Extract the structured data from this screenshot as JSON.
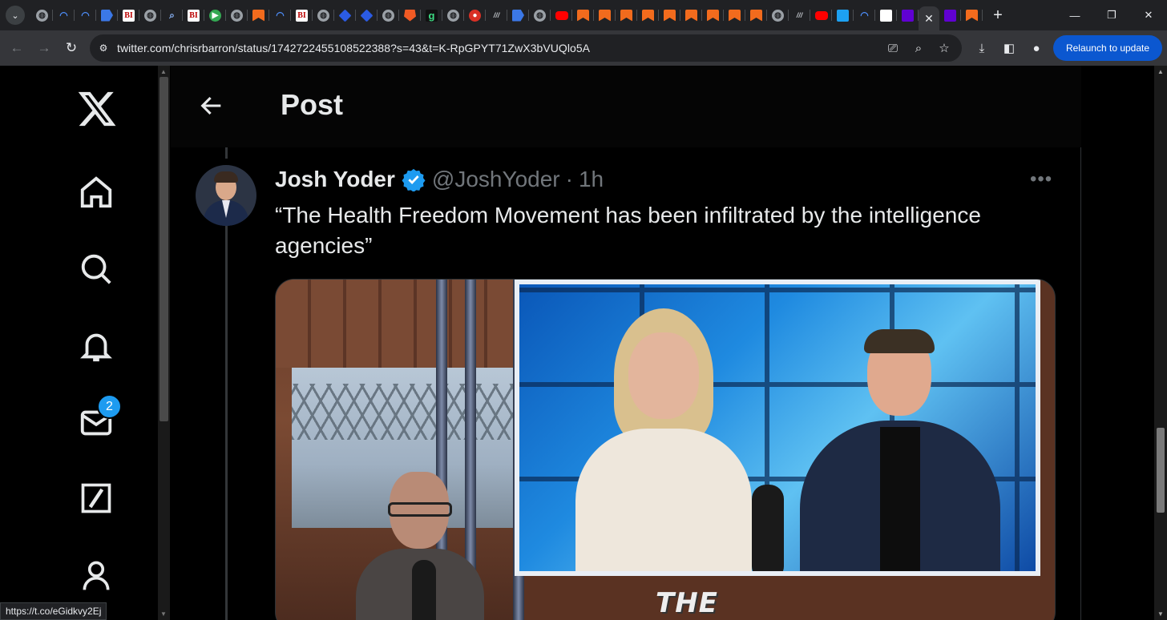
{
  "browser": {
    "url": "twitter.com/chrisrbarron/status/1742722455108522388?s=43&t=K-RpGPYT71ZwX3bVUQlo5A",
    "relaunch_label": "Relaunch to update",
    "status_url": "https://t.co/eGidkvy2Ej",
    "tab_icons": [
      "globe",
      "shield",
      "shield",
      "flag",
      "bi",
      "globe",
      "search",
      "bi",
      "play",
      "globe",
      "bookmark",
      "shield",
      "bi",
      "globe",
      "cube",
      "cube",
      "globe",
      "brave",
      "g",
      "globe",
      "mic",
      "tt",
      "flag",
      "globe",
      "yt",
      "bookmark",
      "bookmark",
      "bookmark",
      "bookmark",
      "bookmark",
      "bookmark",
      "bookmark",
      "bookmark",
      "bookmark",
      "globe",
      "tt",
      "yt",
      "blue",
      "shield",
      "wave",
      "purple"
    ],
    "active_tab_icon": "close-icon",
    "after_tabs": [
      "purple",
      "bookmark"
    ]
  },
  "page": {
    "header_title": "Post",
    "messages_badge": "2"
  },
  "post": {
    "author_name": "Josh Yoder",
    "handle": "@JoshYoder",
    "separator": "·",
    "time": "1h",
    "text": "“The Health Freedom Movement has been infiltrated by the intelligence agencies”",
    "media_overlay_text": "THE"
  },
  "colors": {
    "accent": "#1d9bf0",
    "text_primary": "#e7e9ea",
    "text_secondary": "#71767b",
    "relaunch_bg": "#0b57d0"
  }
}
